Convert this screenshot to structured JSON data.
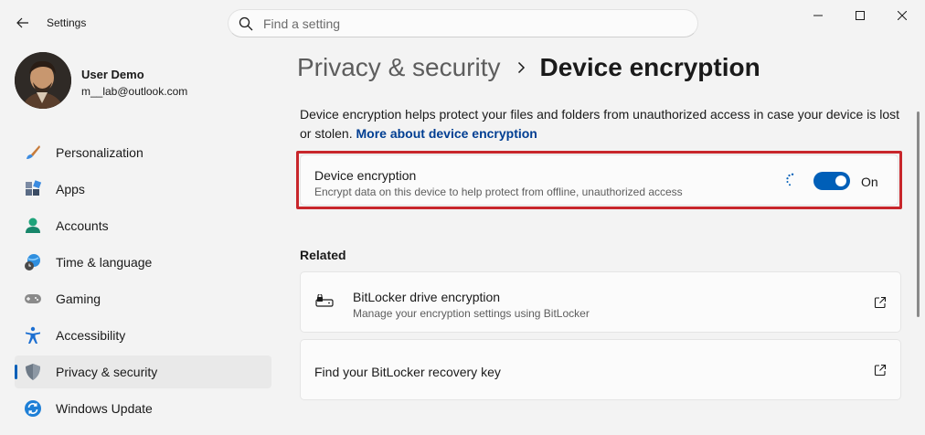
{
  "app": {
    "title": "Settings"
  },
  "search": {
    "placeholder": "Find a setting"
  },
  "user": {
    "name": "User Demo",
    "email": "m__lab@outlook.com"
  },
  "nav": {
    "items": [
      {
        "label": "Personalization",
        "icon": "paintbrush-icon"
      },
      {
        "label": "Apps",
        "icon": "apps-icon"
      },
      {
        "label": "Accounts",
        "icon": "person-icon"
      },
      {
        "label": "Time & language",
        "icon": "globe-clock-icon"
      },
      {
        "label": "Gaming",
        "icon": "gamepad-icon"
      },
      {
        "label": "Accessibility",
        "icon": "accessibility-icon"
      },
      {
        "label": "Privacy & security",
        "icon": "shield-icon",
        "active": true
      },
      {
        "label": "Windows Update",
        "icon": "sync-icon"
      }
    ]
  },
  "breadcrumb": {
    "parent": "Privacy & security",
    "current": "Device encryption"
  },
  "description": {
    "text": "Device encryption helps protect your files and folders from unauthorized access in case your device is lost or stolen.",
    "link": "More about device encryption"
  },
  "encryption_card": {
    "title": "Device encryption",
    "subtitle": "Encrypt data on this device to help protect from offline, unauthorized access",
    "toggle_state": "On",
    "toggle_on": true,
    "busy": true
  },
  "related": {
    "heading": "Related",
    "items": [
      {
        "title": "BitLocker drive encryption",
        "subtitle": "Manage your encryption settings using BitLocker",
        "icon": "bitlocker-drive-icon"
      },
      {
        "title": "Find your BitLocker recovery key",
        "subtitle": ""
      }
    ]
  },
  "colors": {
    "accent": "#005fb8",
    "highlight": "#c8262b",
    "link": "#003e92",
    "background": "#f3f3f3",
    "card": "#fbfbfb"
  }
}
